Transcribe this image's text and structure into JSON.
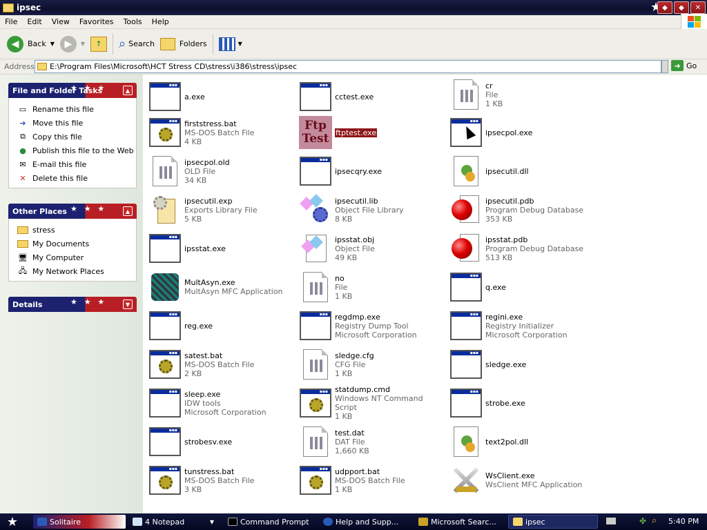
{
  "window": {
    "title": "ipsec"
  },
  "menu": {
    "items": [
      "File",
      "Edit",
      "View",
      "Favorites",
      "Tools",
      "Help"
    ]
  },
  "toolbar": {
    "back": "Back",
    "search": "Search",
    "folders": "Folders"
  },
  "address": {
    "label": "Address",
    "value": "E:\\Program Files\\Microsoft\\HCT Stress CD\\stress\\i386\\stress\\ipsec",
    "go": "Go"
  },
  "tasks_panel": {
    "title": "File and Folder Tasks",
    "items": [
      "Rename this file",
      "Move this file",
      "Copy this file",
      "Publish this file to the Web",
      "E-mail this file",
      "Delete this file"
    ]
  },
  "places_panel": {
    "title": "Other Places",
    "items": [
      "stress",
      "My Documents",
      "My Computer",
      "My Network Places"
    ]
  },
  "details_panel": {
    "title": "Details"
  },
  "files": [
    {
      "name": "a.exe",
      "l2": "",
      "l3": ""
    },
    {
      "name": "cctest.exe",
      "l2": "",
      "l3": ""
    },
    {
      "name": "cr",
      "l2": "File",
      "l3": "1 KB"
    },
    {
      "name": "firststress.bat",
      "l2": "MS-DOS Batch File",
      "l3": "4 KB"
    },
    {
      "name": "ftptest.exe",
      "l2": "",
      "l3": ""
    },
    {
      "name": "ipsecpol.exe",
      "l2": "",
      "l3": ""
    },
    {
      "name": "ipsecpol.old",
      "l2": "OLD File",
      "l3": "34 KB"
    },
    {
      "name": "ipsecqry.exe",
      "l2": "",
      "l3": ""
    },
    {
      "name": "ipsecutil.dll",
      "l2": "",
      "l3": ""
    },
    {
      "name": "ipsecutil.exp",
      "l2": "Exports Library File",
      "l3": "5 KB"
    },
    {
      "name": "ipsecutil.lib",
      "l2": "Object File Library",
      "l3": "8 KB"
    },
    {
      "name": "ipsecutil.pdb",
      "l2": "Program Debug Database",
      "l3": "353 KB"
    },
    {
      "name": "ipsstat.exe",
      "l2": "",
      "l3": ""
    },
    {
      "name": "ipsstat.obj",
      "l2": "Object File",
      "l3": "49 KB"
    },
    {
      "name": "ipsstat.pdb",
      "l2": "Program Debug Database",
      "l3": "513 KB"
    },
    {
      "name": "MultAsyn.exe",
      "l2": "MultAsyn MFC Application",
      "l3": ""
    },
    {
      "name": "no",
      "l2": "File",
      "l3": "1 KB"
    },
    {
      "name": "q.exe",
      "l2": "",
      "l3": ""
    },
    {
      "name": "reg.exe",
      "l2": "",
      "l3": ""
    },
    {
      "name": "regdmp.exe",
      "l2": "Registry Dump Tool",
      "l3": "Microsoft Corporation"
    },
    {
      "name": "regini.exe",
      "l2": "Registry Initializer",
      "l3": "Microsoft Corporation"
    },
    {
      "name": "satest.bat",
      "l2": "MS-DOS Batch File",
      "l3": "2 KB"
    },
    {
      "name": "sledge.cfg",
      "l2": "CFG File",
      "l3": "1 KB"
    },
    {
      "name": "sledge.exe",
      "l2": "",
      "l3": ""
    },
    {
      "name": "sleep.exe",
      "l2": "IDW tools",
      "l3": "Microsoft Corporation"
    },
    {
      "name": "statdump.cmd",
      "l2": "Windows NT Command Script",
      "l3": "1 KB"
    },
    {
      "name": "strobe.exe",
      "l2": "",
      "l3": ""
    },
    {
      "name": "strobesv.exe",
      "l2": "",
      "l3": ""
    },
    {
      "name": "test.dat",
      "l2": "DAT File",
      "l3": "1,660 KB"
    },
    {
      "name": "text2pol.dll",
      "l2": "",
      "l3": ""
    },
    {
      "name": "tunstress.bat",
      "l2": "MS-DOS Batch File",
      "l3": "3 KB"
    },
    {
      "name": "udpport.bat",
      "l2": "MS-DOS Batch File",
      "l3": "1 KB"
    },
    {
      "name": "WsClient.exe",
      "l2": "WsClient MFC Application",
      "l3": ""
    }
  ],
  "ftp_icon": {
    "line1": "Ftp",
    "line2": "Test"
  },
  "taskbar": {
    "tasks": [
      "Solitaire",
      "4 Notepad",
      "Command Prompt",
      "Help and Supp...",
      "Microsoft Searc...",
      "ipsec"
    ],
    "clock": "5:40 PM"
  }
}
